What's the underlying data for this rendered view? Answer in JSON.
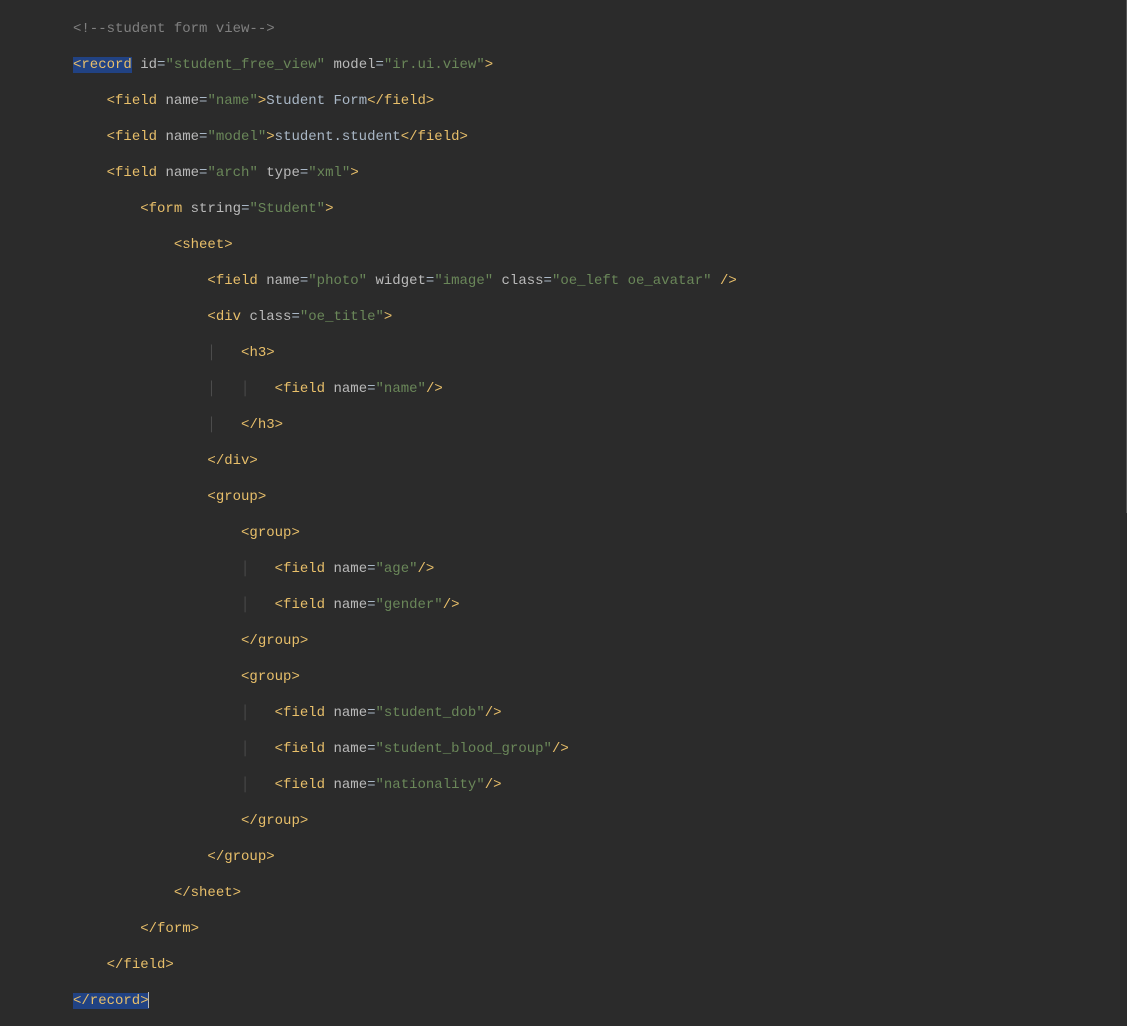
{
  "code": {
    "comment": "<!--student form view-->",
    "record_open": "<record",
    "record_id_attr": "id",
    "record_id_val": "\"student_free_view\"",
    "model_attr": "model",
    "model_val": "\"ir.ui.view\"",
    "field_open": "<field",
    "field_close": "</field>",
    "name_attr": "name",
    "name_val_name": "\"name\"",
    "name_val_model": "\"model\"",
    "name_val_arch": "\"arch\"",
    "name_val_photo": "\"photo\"",
    "name_val_age": "\"age\"",
    "name_val_gender": "\"gender\"",
    "name_val_dob": "\"student_dob\"",
    "name_val_blood": "\"student_blood_group\"",
    "name_val_nationality": "\"nationality\"",
    "student_form_text": "Student Form",
    "student_student_text": "student.student",
    "type_attr": "type",
    "type_val": "\"xml\"",
    "form_open": "<form",
    "form_close": "</form>",
    "string_attr": "string",
    "string_val": "\"Student\"",
    "sheet_open": "<sheet>",
    "sheet_close": "</sheet>",
    "widget_attr": "widget",
    "widget_val": "\"image\"",
    "class_attr": "class",
    "class_val_avatar": "\"oe_left oe_avatar\"",
    "class_val_title": "\"oe_title\"",
    "div_open": "<div",
    "div_close": "</div>",
    "h3_open": "<h3>",
    "h3_close": "</h3>",
    "group_open": "<group>",
    "group_close": "</group>",
    "record_close": "</record>",
    "self_close": "/>",
    "close_bracket": ">",
    "space": " "
  }
}
